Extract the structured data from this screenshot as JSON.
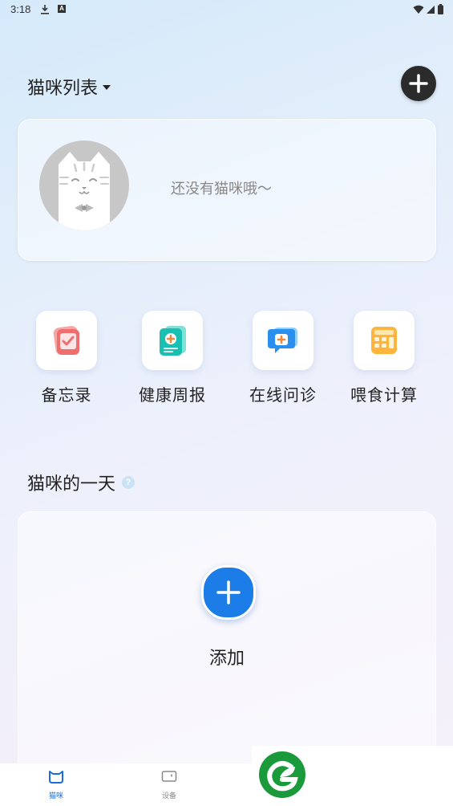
{
  "status_bar": {
    "time": "3:18",
    "a_icon_label": "A"
  },
  "cat_list": {
    "title": "猫咪列表",
    "empty_message": "还没有猫咪哦～"
  },
  "features": [
    {
      "label": "备忘录",
      "icon": "memo-icon"
    },
    {
      "label": "健康周报",
      "icon": "health-report-icon"
    },
    {
      "label": "在线问诊",
      "icon": "consultation-icon"
    },
    {
      "label": "喂食计算",
      "icon": "feeding-calculator-icon"
    }
  ],
  "cat_day": {
    "title": "猫咪的一天",
    "help_glyph": "?",
    "add_label": "添加"
  },
  "tabs": [
    {
      "label": "猫咪",
      "icon": "cat-icon",
      "active": true
    },
    {
      "label": "设备",
      "icon": "device-icon",
      "active": false
    }
  ],
  "colors": {
    "accent": "#1c7de8",
    "tab_active": "#1a6fd6",
    "tab_inactive": "#888888",
    "logo_green": "#1a9a3a"
  }
}
